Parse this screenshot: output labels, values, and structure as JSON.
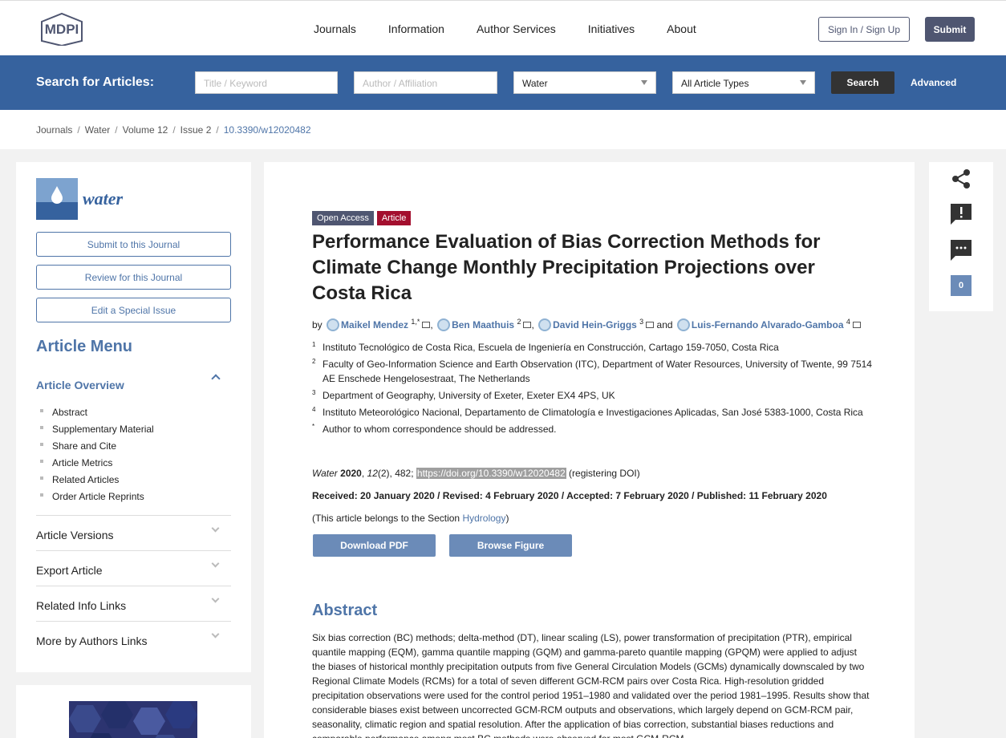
{
  "header": {
    "logo_text": "MDPI",
    "nav": [
      "Journals",
      "Information",
      "Author Services",
      "Initiatives",
      "About"
    ],
    "sign_in": "Sign In / Sign Up",
    "submit": "Submit"
  },
  "search": {
    "label": "Search for Articles:",
    "keyword_placeholder": "Title / Keyword",
    "author_placeholder": "Author / Affiliation",
    "journal_value": "Water",
    "type_value": "All Article Types",
    "button": "Search",
    "advanced": "Advanced"
  },
  "breadcrumb": {
    "items": [
      "Journals",
      "Water",
      "Volume 12",
      "Issue 2"
    ],
    "current": "10.3390/w12020482"
  },
  "sidebar": {
    "journal_name": "water",
    "buttons": [
      "Submit to this Journal",
      "Review for this Journal",
      "Edit a Special Issue"
    ],
    "menu_title": "Article Menu",
    "overview_title": "Article Overview",
    "overview_items": [
      "Abstract",
      "Supplementary Material",
      "Share and Cite",
      "Article Metrics",
      "Related Articles",
      "Order Article Reprints"
    ],
    "sections": [
      "Article Versions",
      "Export Article",
      "Related Info Links",
      "More by Authors Links"
    ]
  },
  "article": {
    "badge_oa": "Open Access",
    "badge_type": "Article",
    "title": "Performance Evaluation of Bias Correction Methods for Climate Change Monthly Precipitation Projections over Costa Rica",
    "by": "by",
    "authors": [
      {
        "name": "Maikel Mendez",
        "sup": "1,*"
      },
      {
        "name": "Ben Maathuis",
        "sup": "2"
      },
      {
        "name": "David Hein-Griggs",
        "sup": "3"
      },
      {
        "name": "Luis-Fernando Alvarado-Gamboa",
        "sup": "4"
      }
    ],
    "and": "and",
    "affiliations": [
      {
        "num": "1",
        "text": "Instituto Tecnológico de Costa Rica, Escuela de Ingeniería en Construcción, Cartago 159-7050, Costa Rica"
      },
      {
        "num": "2",
        "text": "Faculty of Geo-Information Science and Earth Observation (ITC), Department of Water Resources, University of Twente, 99 7514 AE Enschede Hengelosestraat, The Netherlands"
      },
      {
        "num": "3",
        "text": "Department of Geography, University of Exeter, Exeter EX4 4PS, UK"
      },
      {
        "num": "4",
        "text": "Instituto Meteorológico Nacional, Departamento de Climatología e Investigaciones Aplicadas, San José 5383-1000, Costa Rica"
      },
      {
        "num": "*",
        "text": "Author to whom correspondence should be addressed."
      }
    ],
    "citation": {
      "journal": "Water",
      "year": "2020",
      "volume": "12",
      "issue_page": "(2), 482; ",
      "doi": "https://doi.org/10.3390/w12020482",
      "note": " (registering DOI)"
    },
    "dates": "Received: 20 January 2020 / Revised: 4 February 2020 / Accepted: 7 February 2020 / Published: 11 February 2020",
    "section_prefix": "(This article belongs to the Section ",
    "section_name": "Hydrology",
    "section_suffix": ")",
    "download_pdf": "Download PDF",
    "browse_figure": "Browse Figure",
    "abstract_heading": "Abstract",
    "abstract_text": "Six bias correction (BC) methods; delta-method (DT), linear scaling (LS), power transformation of precipitation (PTR), empirical quantile mapping (EQM), gamma quantile mapping (GQM) and gamma-pareto quantile mapping (GPQM) were applied to adjust the biases of historical monthly precipitation outputs from five General Circulation Models (GCMs) dynamically downscaled by two Regional Climate Models (RCMs) for a total of seven different GCM-RCM pairs over Costa Rica. High-resolution gridded precipitation observations were used for the control period 1951–1980 and validated over the period 1981–1995. Results show that considerable biases exist between uncorrected GCM-RCM outputs and observations, which largely depend on GCM-RCM pair, seasonality, climatic region and spatial resolution. After the application of bias correction, substantial biases reductions and comparable performance among most BC methods were observed for most GCM-RCM"
  },
  "tools": {
    "comment_count": "0"
  }
}
